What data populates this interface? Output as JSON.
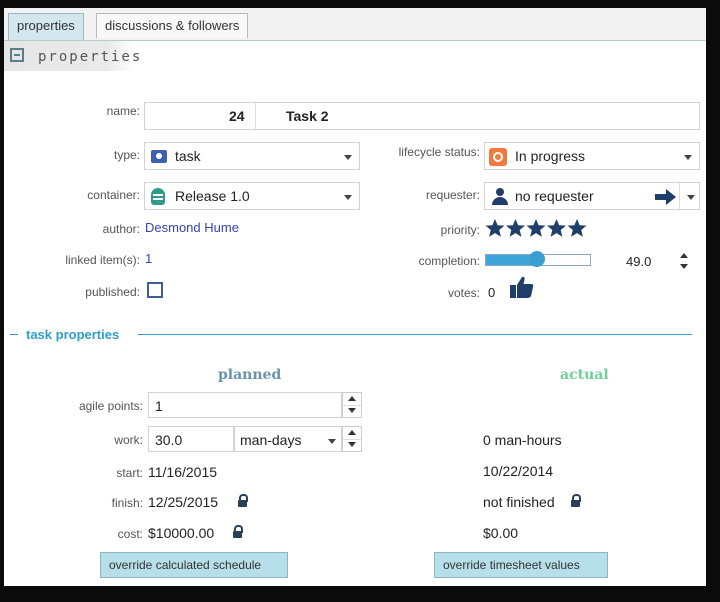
{
  "tabs": [
    {
      "label": "properties"
    },
    {
      "label": "discussions & followers"
    }
  ],
  "section": {
    "title": "properties"
  },
  "fields": {
    "name": {
      "label": "name:",
      "id": "24",
      "value": "Task 2"
    },
    "type": {
      "label": "type:",
      "value": "task",
      "icon": "task-icon"
    },
    "lifecycle": {
      "label": "lifecycle status:",
      "value": "In progress",
      "icon": "status-icon",
      "color": "#f07a3b"
    },
    "container": {
      "label": "container:",
      "value": "Release 1.0",
      "icon": "release-icon",
      "color": "#2f9a8a"
    },
    "requester": {
      "label": "requester:",
      "value": "no requester",
      "icon": "person-icon"
    },
    "author": {
      "label": "author:",
      "value": "Desmond Hume"
    },
    "priority": {
      "label": "priority:",
      "stars": 5,
      "max": 5
    },
    "linked": {
      "label": "linked item(s):",
      "value": "1"
    },
    "completion": {
      "label": "completion:",
      "value": "49.0",
      "fraction": 0.49
    },
    "published": {
      "label": "published:",
      "checked": false
    },
    "votes": {
      "label": "votes:",
      "value": "0",
      "icon": "thumbs-up-icon"
    }
  },
  "task": {
    "title": "task properties",
    "planned_header": "planned",
    "actual_header": "actual",
    "agile_points": {
      "label": "agile points:",
      "value": "1"
    },
    "work": {
      "label": "work:",
      "value": "30.0",
      "unit": "man-days",
      "actual": "0 man-hours"
    },
    "start": {
      "label": "start:",
      "planned": "11/16/2015",
      "actual": "10/22/2014"
    },
    "finish": {
      "label": "finish:",
      "planned": "12/25/2015",
      "actual": "not finished"
    },
    "cost": {
      "label": "cost:",
      "planned": "$10000.00",
      "actual": "$0.00"
    },
    "override_schedule": "override calculated schedule",
    "override_timesheet": "override timesheet values"
  },
  "colors": {
    "accent": "#2ea0c8",
    "actual": "#6fcf97",
    "planned": "#6a93ad",
    "link": "#3444b0",
    "stars": "#1f3e6a"
  }
}
